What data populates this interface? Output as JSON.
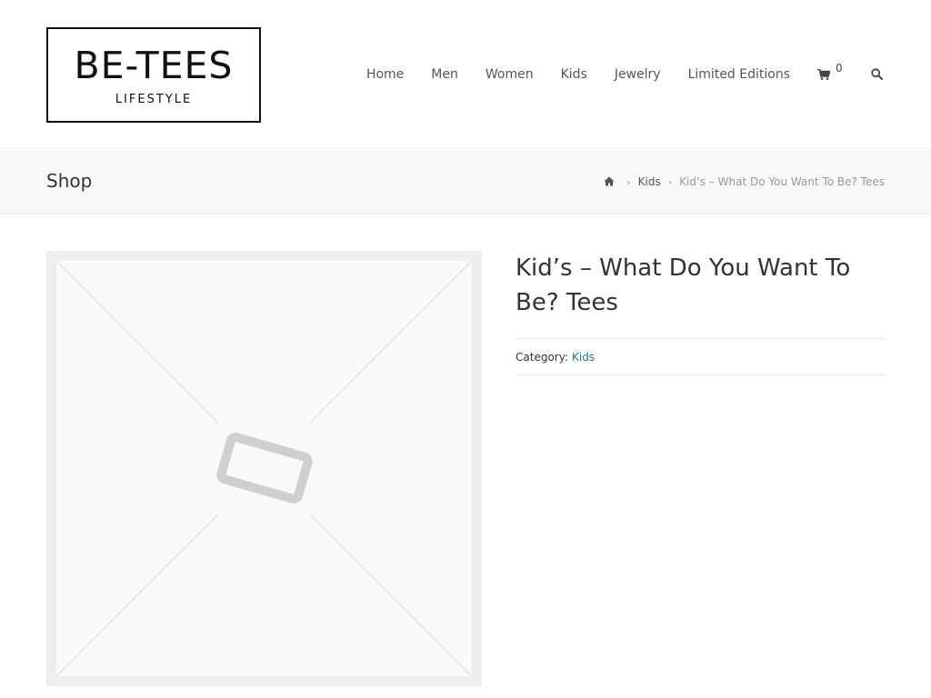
{
  "logo": {
    "main": "BE-TEES",
    "sub": "LIFESTYLE"
  },
  "nav": {
    "items": [
      "Home",
      "Men",
      "Women",
      "Kids",
      "Jewelry",
      "Limited Editions"
    ],
    "cart_icon": "shopping-cart-icon",
    "cart_count": "0",
    "search_icon": "search-icon"
  },
  "titlebar": {
    "title": "Shop",
    "breadcrumb": {
      "home_icon": "home-icon",
      "category": "Kids",
      "current": "Kid’s – What Do You Want To Be? Tees"
    }
  },
  "product": {
    "image_icon": "image-placeholder-icon",
    "title": "Kid’s – What Do You Want To Be? Tees",
    "category_label": "Category:",
    "category_value": "Kids"
  },
  "colors": {
    "accent_link": "#1e73be",
    "titlebar_bg": "#f8f8f8",
    "text": "#333333"
  }
}
